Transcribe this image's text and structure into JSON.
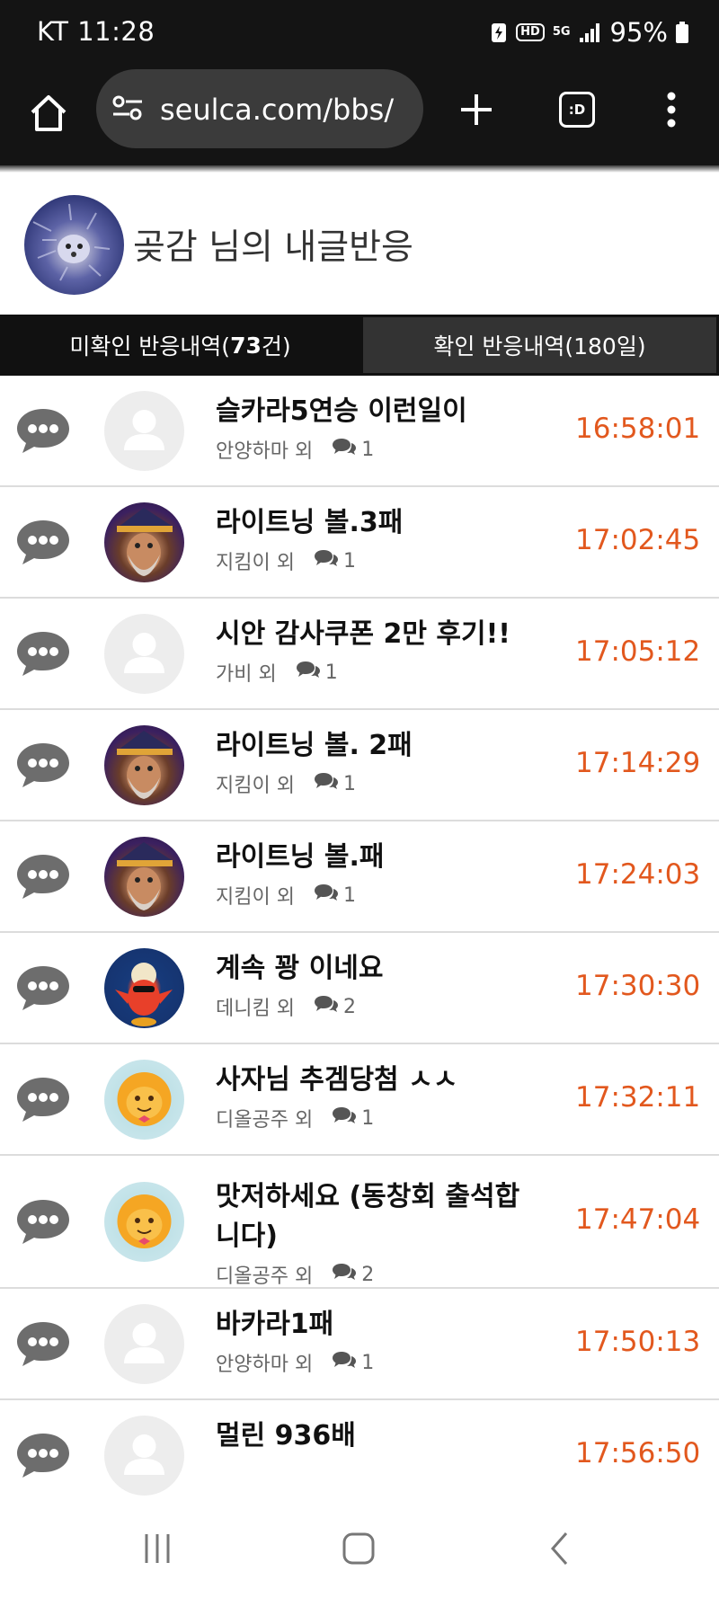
{
  "status_bar": {
    "carrier_time": "KT 11:28",
    "hd": "HD",
    "network": "5G",
    "battery": "95%"
  },
  "browser": {
    "url": "seulca.com/bbs/",
    "tabs_label": ":D"
  },
  "header": {
    "title": "곶감 님의 내글반응"
  },
  "tabs": {
    "unread_prefix": "미확인 반응내역(",
    "unread_count": "73",
    "unread_suffix": "건)",
    "read_label": "확인 반응내역(180일)"
  },
  "reactions": [
    {
      "title": "슬카라5연승 이런일이",
      "user": "안양하마 외",
      "count": "1",
      "time": "16:58:01",
      "avatar": "default"
    },
    {
      "title": "라이트닝 볼.3패",
      "user": "지킴이 외",
      "count": "1",
      "time": "17:02:45",
      "avatar": "wizard"
    },
    {
      "title": "시안 감사쿠폰 2만 후기!!",
      "user": "가비 외",
      "count": "1",
      "time": "17:05:12",
      "avatar": "default"
    },
    {
      "title": "라이트닝 볼. 2패",
      "user": "지킴이 외",
      "count": "1",
      "time": "17:14:29",
      "avatar": "wizard"
    },
    {
      "title": "라이트닝 볼.패",
      "user": "지킴이 외",
      "count": "1",
      "time": "17:24:03",
      "avatar": "wizard"
    },
    {
      "title": "계속 꽝 이네요",
      "user": "데니킴 외",
      "count": "2",
      "time": "17:30:30",
      "avatar": "bird"
    },
    {
      "title": "사자님 추겜당첨 ㅅㅅ",
      "user": "디올공주 외",
      "count": "1",
      "time": "17:32:11",
      "avatar": "lion"
    },
    {
      "title": "맛저하세요 (동창회 출석합니다)",
      "user": "디올공주 외",
      "count": "2",
      "time": "17:47:04",
      "avatar": "lion"
    },
    {
      "title": "바카라1패",
      "user": "안양하마 외",
      "count": "1",
      "time": "17:50:13",
      "avatar": "default"
    },
    {
      "title": "멀린 936배",
      "user": "",
      "count": "",
      "time": "17:56:50",
      "avatar": "default"
    }
  ]
}
